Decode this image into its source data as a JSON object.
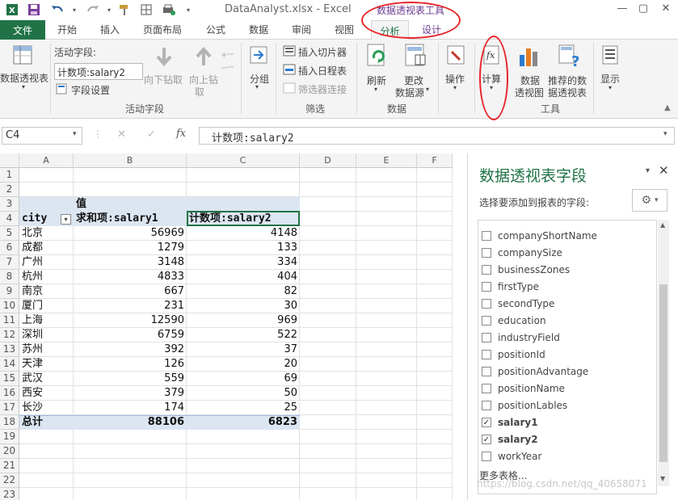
{
  "window": {
    "title": "DataAnalyst.xlsx - Excel",
    "context_title": "数据透视表工具"
  },
  "tabs": {
    "file": "文件",
    "home": "开始",
    "insert": "插入",
    "layout": "页面布局",
    "formulas": "公式",
    "data": "数据",
    "review": "审阅",
    "view": "视图",
    "analyze": "分析",
    "design": "设计"
  },
  "ribbon": {
    "pivottable_btn": "数据透视表",
    "active_field_label": "活动字段:",
    "active_field_value": "计数项:salary2",
    "field_settings": "字段设置",
    "drill_down": "向下钻取",
    "drill_up_1": "向上钻",
    "drill_up_2": "取",
    "group_active_field": "活动字段",
    "group_btn": "分组",
    "insert_slicer": "插入切片器",
    "insert_timeline": "插入日程表",
    "filter_connections": "筛选器连接",
    "group_filter": "筛选",
    "refresh": "刷新",
    "change_source_1": "更改",
    "change_source_2": "数据源",
    "group_data": "数据",
    "actions": "操作",
    "calculations": "计算",
    "pivotchart_1": "数据",
    "pivotchart_2": "透视图",
    "recommended_1": "推荐的数",
    "recommended_2": "据透视表",
    "group_tools": "工具",
    "show": "显示"
  },
  "formula_bar": {
    "name_box": "C4",
    "fx": "fx",
    "formula": "计数项:salary2"
  },
  "grid": {
    "columns": [
      "A",
      "B",
      "C",
      "D",
      "E",
      "F"
    ],
    "rows": [
      "1",
      "2",
      "3",
      "4",
      "5",
      "6",
      "7",
      "8",
      "9",
      "10",
      "11",
      "12",
      "13",
      "14",
      "15",
      "16",
      "17",
      "18",
      "19",
      "20",
      "21",
      "22",
      "23"
    ],
    "header_value": "值",
    "header_city": "city",
    "header_sum": "求和项:salary1",
    "header_count": "计数项:salary2",
    "data": [
      {
        "city": "北京",
        "sum": "56969",
        "count": "4148"
      },
      {
        "city": "成都",
        "sum": "1279",
        "count": "133"
      },
      {
        "city": "广州",
        "sum": "3148",
        "count": "334"
      },
      {
        "city": "杭州",
        "sum": "4833",
        "count": "404"
      },
      {
        "city": "南京",
        "sum": "667",
        "count": "82"
      },
      {
        "city": "厦门",
        "sum": "231",
        "count": "30"
      },
      {
        "city": "上海",
        "sum": "12590",
        "count": "969"
      },
      {
        "city": "深圳",
        "sum": "6759",
        "count": "522"
      },
      {
        "city": "苏州",
        "sum": "392",
        "count": "37"
      },
      {
        "city": "天津",
        "sum": "126",
        "count": "20"
      },
      {
        "city": "武汉",
        "sum": "559",
        "count": "69"
      },
      {
        "city": "西安",
        "sum": "379",
        "count": "50"
      },
      {
        "city": "长沙",
        "sum": "174",
        "count": "25"
      }
    ],
    "total_label": "总计",
    "total_sum": "88106",
    "total_count": "6823"
  },
  "panel": {
    "title": "数据透视表字段",
    "subtitle": "选择要添加到报表的字段:",
    "fields": [
      {
        "name": "companyShortName",
        "checked": false
      },
      {
        "name": "companySize",
        "checked": false
      },
      {
        "name": "businessZones",
        "checked": false
      },
      {
        "name": "firstType",
        "checked": false
      },
      {
        "name": "secondType",
        "checked": false
      },
      {
        "name": "education",
        "checked": false
      },
      {
        "name": "industryField",
        "checked": false
      },
      {
        "name": "positionId",
        "checked": false
      },
      {
        "name": "positionAdvantage",
        "checked": false
      },
      {
        "name": "positionName",
        "checked": false
      },
      {
        "name": "positionLables",
        "checked": false
      },
      {
        "name": "salary1",
        "checked": true
      },
      {
        "name": "salary2",
        "checked": true
      },
      {
        "name": "workYear",
        "checked": false
      }
    ],
    "more_tables": "更多表格..."
  },
  "watermark": "https://blog.csdn.net/qq_40658071",
  "colors": {
    "excel_green": "#217346",
    "annotation_red": "#e8262a",
    "pivot_header_blue": "#dce6f1"
  }
}
